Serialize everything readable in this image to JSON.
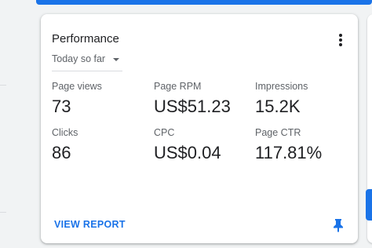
{
  "card": {
    "title": "Performance",
    "range": "Today so far",
    "metrics": [
      {
        "label": "Page views",
        "value": "73"
      },
      {
        "label": "Page RPM",
        "value": "US$51.23"
      },
      {
        "label": "Impressions",
        "value": "15.2K"
      },
      {
        "label": "Clicks",
        "value": "86"
      },
      {
        "label": "CPC",
        "value": "US$0.04"
      },
      {
        "label": "Page CTR",
        "value": "117.81%"
      }
    ],
    "view_report_label": "VIEW REPORT"
  },
  "icons": {
    "more": "more-vert-icon",
    "pin": "pin-icon",
    "caret": "caret-down-icon"
  },
  "colors": {
    "accent": "#1a73e8",
    "text_primary": "#202124",
    "text_secondary": "#5f6368"
  }
}
